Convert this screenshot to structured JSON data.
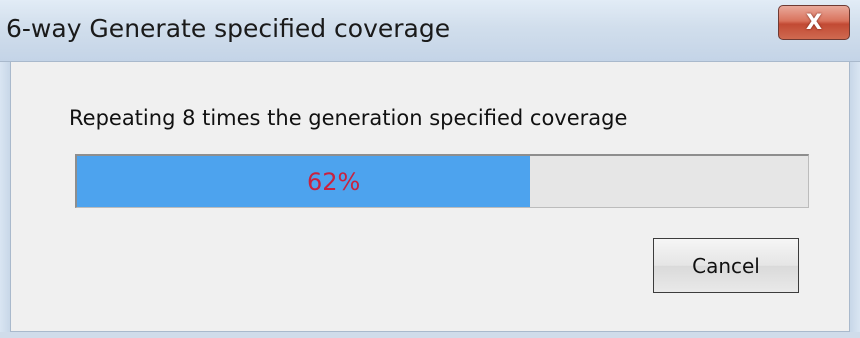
{
  "window": {
    "title": "6-way Generate specified coverage",
    "close_label": "X"
  },
  "dialog": {
    "message": "Repeating 8 times the generation specified coverage",
    "progress": {
      "percent": 62,
      "label": "62%",
      "fill_color": "#4da3ee",
      "text_color": "#c8223f"
    },
    "cancel_label": "Cancel"
  }
}
